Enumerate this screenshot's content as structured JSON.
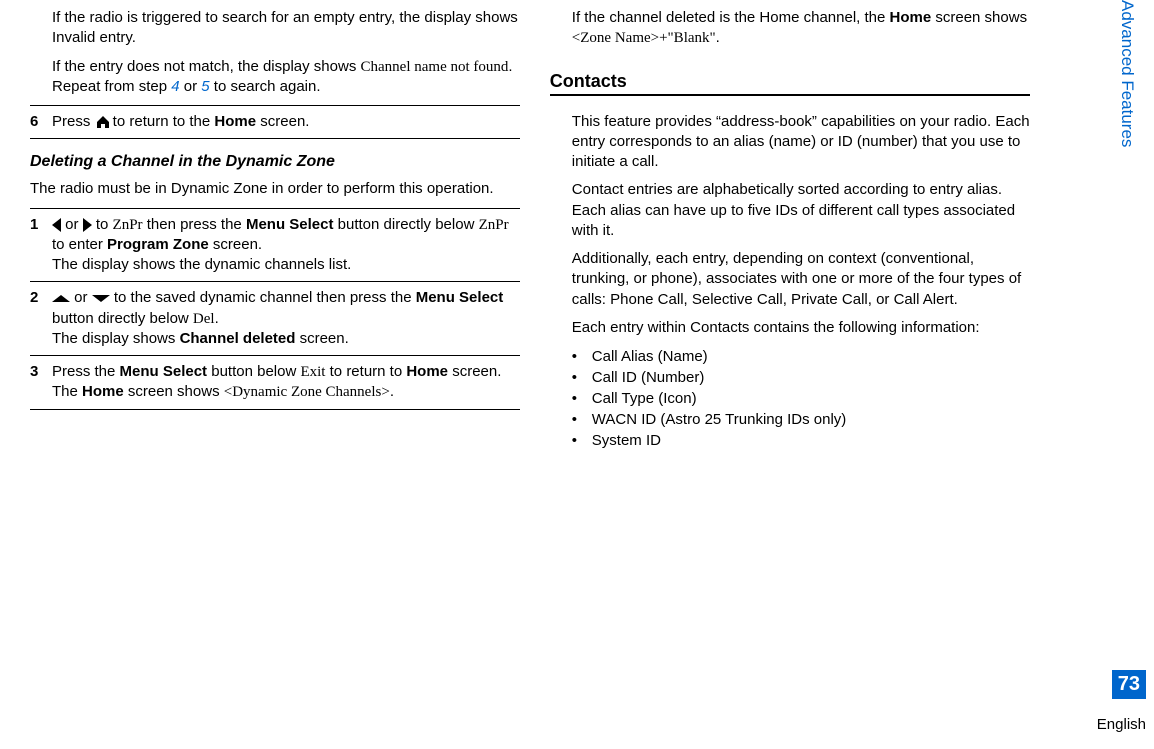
{
  "sideTab": "Advanced Features",
  "pageNum": "73",
  "lang": "English",
  "left": {
    "p1a": "If the radio is triggered to search for an empty entry, the display shows Invalid entry.",
    "p1b_a": "If the entry does not match, the display shows ",
    "p1b_serif": "Channel name not found",
    "p1b_b": ". Repeat from step ",
    "p1b_link1": "4",
    "p1b_c": " or ",
    "p1b_link2": "5",
    "p1b_d": " to search again.",
    "step6_num": "6",
    "step6_a": "Press ",
    "step6_b": " to return to the ",
    "step6_bold": "Home",
    "step6_c": " screen.",
    "subhead": "Deleting a Channel in the Dynamic Zone",
    "intro": "The radio must be in Dynamic Zone in order to perform this operation.",
    "s1_num": "1",
    "s1_a": " or ",
    "s1_b": " to ",
    "s1_serif1": "ZnPr",
    "s1_c": " then press the ",
    "s1_bold1": "Menu Select",
    "s1_d": " button directly below ",
    "s1_serif2": "ZnPr",
    "s1_e": " to enter ",
    "s1_bold2": "Program Zone",
    "s1_f": " screen.",
    "s1_g": "The display shows the dynamic channels list.",
    "s2_num": "2",
    "s2_a": " or ",
    "s2_b": " to the saved dynamic channel then press the ",
    "s2_bold1": "Menu Select",
    "s2_c": " button directly below ",
    "s2_serif": "Del",
    "s2_d": ".",
    "s2_e": "The display shows ",
    "s2_bold2": "Channel deleted",
    "s2_f": " screen.",
    "s3_num": "3",
    "s3_a": "Press the ",
    "s3_bold1": "Menu Select",
    "s3_b": " button below ",
    "s3_serif1": "Exit",
    "s3_c": " to return to ",
    "s3_bold2": "Home",
    "s3_d": " screen.",
    "s3_e": "The ",
    "s3_bold3": "Home",
    "s3_f": " screen shows ",
    "s3_serif2": "<Dynamic Zone Channels>",
    "s3_g": "."
  },
  "right": {
    "top_a": "If the channel deleted is the Home channel, the ",
    "top_bold": "Home",
    "top_b": " screen shows ",
    "top_serif": "<Zone Name>+\"Blank\"",
    "top_c": ".",
    "contacts_head": "Contacts",
    "p1": "This feature provides “address-book” capabilities on your radio. Each entry corresponds to an alias (name) or ID (number) that you use to initiate a call.",
    "p2": "Contact entries are alphabetically sorted according to entry alias. Each alias can have up to five IDs of different call types associated with it.",
    "p3": "Additionally, each entry, depending on context (conventional, trunking, or phone), associates with one or more of the four types of calls: Phone Call, Selective Call, Private Call, or Call Alert.",
    "p4": "Each entry within Contacts contains the following information:",
    "bullets": {
      "b0": "Call Alias (Name)",
      "b1": "Call ID (Number)",
      "b2": "Call Type (Icon)",
      "b3": "WACN ID (Astro 25 Trunking IDs only)",
      "b4": "System ID"
    }
  }
}
